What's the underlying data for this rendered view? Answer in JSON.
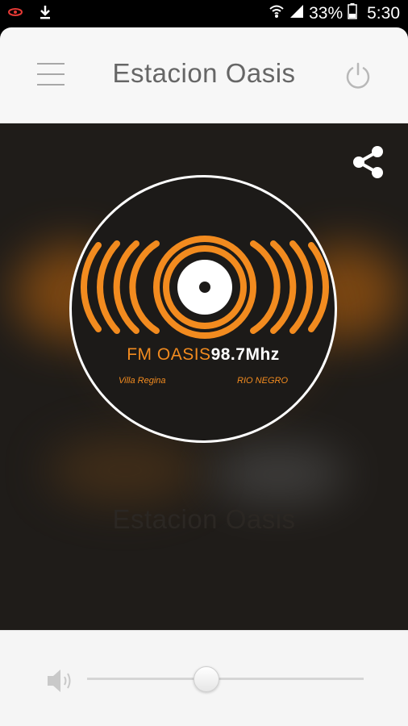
{
  "status_bar": {
    "battery": "33%",
    "time": "5:30",
    "icons": [
      "notification-icon",
      "download-icon",
      "wifi-icon",
      "signal-icon",
      "battery-icon"
    ]
  },
  "header": {
    "title": "Estacion Oasis",
    "menu_icon": "hamburger-menu-icon",
    "power_icon": "power-icon"
  },
  "player": {
    "share_icon": "share-icon",
    "logo": {
      "brand_name": "FM OASIS",
      "frequency": "98.7Mhz",
      "city": "Villa Regina",
      "region": "RIO NEGRO"
    },
    "station_name": "Estacion Oasis"
  },
  "volume": {
    "icon": "volume-icon",
    "level": 0.43
  },
  "colors": {
    "accent_orange": "#f28b1f",
    "header_bg": "#f7f7f7",
    "player_bg": "#1f1c19",
    "title_text": "#666666"
  }
}
